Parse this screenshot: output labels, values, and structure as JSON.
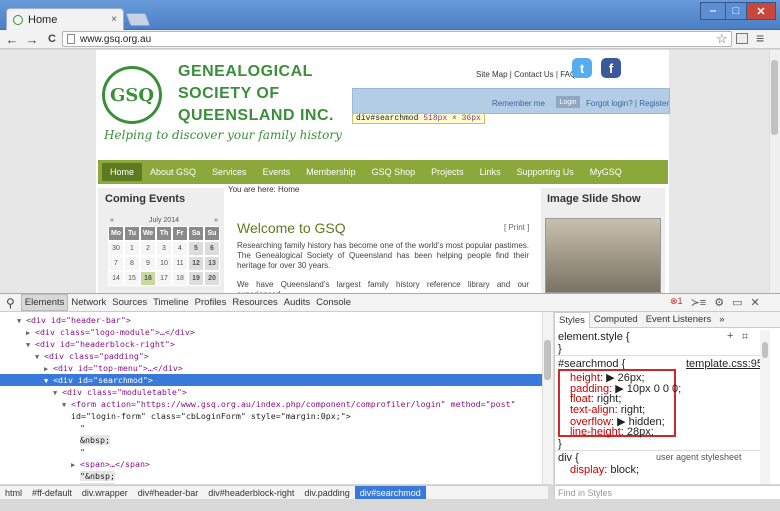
{
  "browser": {
    "tab_title": "Home",
    "tab_close": "×",
    "url": "www.gsq.org.au",
    "window_buttons": {
      "minimize": "‒",
      "maximize": "□",
      "close": "✕"
    },
    "nav": {
      "back": "←",
      "forward": "→",
      "reload": "C",
      "star": "☆",
      "menu": "≡"
    }
  },
  "site": {
    "logo_text": "GSQ",
    "name_lines": [
      "GENEALOGICAL",
      "SOCIETY OF",
      "QUEENSLAND INC."
    ],
    "tagline": "Helping to discover your family history",
    "top_links": "Site Map | Contact Us | FAQ",
    "twitter": "t",
    "facebook": "f",
    "remember_me": "Remember me",
    "login_button": "Login",
    "forgot_links": "Forgot login? | Register",
    "menu": [
      "Home",
      "About GSQ",
      "Services",
      "Events",
      "Membership",
      "GSQ Shop",
      "Projects",
      "Links",
      "Supporting Us",
      "MyGSQ"
    ],
    "coming_events": "Coming Events",
    "calendar": {
      "month": "July 2014",
      "prev": "«",
      "next": "»",
      "days": [
        "Mo",
        "Tu",
        "We",
        "Th",
        "Fr",
        "Sa",
        "Su"
      ],
      "rows": [
        [
          "30",
          "1",
          "2",
          "3",
          "4",
          "5",
          "6"
        ],
        [
          "7",
          "8",
          "9",
          "10",
          "11",
          "12",
          "13"
        ],
        [
          "14",
          "15",
          "16",
          "17",
          "18",
          "19",
          "20"
        ]
      ]
    },
    "breadcrumb": "You are here: Home",
    "welcome_title": "Welcome to GSQ",
    "print_link": "[ Print ]",
    "paragraph1": "Researching family history has become one of the world’s most popular pastimes. The Genealogical Society of Queensland has been helping people find their heritage for over 30 years.",
    "paragraph2": "We have Queensland’s largest family history reference library and our experienced",
    "image_slide_show": "Image Slide Show",
    "tooltip_selector": "div#searchmod",
    "tooltip_size": "518px × 36px"
  },
  "devtools": {
    "tabs": [
      "Elements",
      "Network",
      "Sources",
      "Timeline",
      "Profiles",
      "Resources",
      "Audits",
      "Console"
    ],
    "error_count": "1",
    "dom_lines": [
      {
        "indent": 3,
        "open": true,
        "tag": "<div id=\"header-bar\">"
      },
      {
        "indent": 4,
        "open": false,
        "tag": "<div class=\"logo-module\">…</div>"
      },
      {
        "indent": 4,
        "open": true,
        "tag": "<div id=\"headerblock-right\">"
      },
      {
        "indent": 5,
        "open": true,
        "tag": "<div class=\"padding\">"
      },
      {
        "indent": 6,
        "open": false,
        "tag": "<div id=\"top-menu\">…</div>"
      },
      {
        "indent": 6,
        "open": true,
        "tag": "<div id=\"searchmod\">"
      },
      {
        "indent": 7,
        "open": true,
        "tag": "<div class=\"moduletable\">"
      },
      {
        "indent": 8,
        "open": true,
        "tag": "<form action=\"https://www.gsq.org.au/index.php/component/comprofiler/login\" method=\"post\""
      },
      {
        "indent": 8,
        "open": null,
        "tag": "id=\"login-form\" class=\"cbLoginForm\" style=\"margin:0px;\">"
      },
      {
        "indent": 9,
        "open": null,
        "tag": "\""
      },
      {
        "indent": 9,
        "open": null,
        "tag": "&nbsp;"
      },
      {
        "indent": 9,
        "open": null,
        "tag": "\""
      },
      {
        "indent": 9,
        "open": false,
        "tag": "<span>…</span>"
      },
      {
        "indent": 9,
        "open": null,
        "tag": "\"&nbsp;"
      },
      {
        "indent": 9,
        "open": null,
        "tag": "&nbsp;\""
      }
    ],
    "styles_tabs": [
      "Styles",
      "Computed",
      "Event Listeners",
      "»"
    ],
    "element_style": "element.style {",
    "element_style_close": "}",
    "rule_selector": "#searchmod {",
    "rule_source": "template.css:95",
    "declarations": [
      {
        "prop": "height",
        "value": "▶ 26px;"
      },
      {
        "prop": "padding",
        "value": "▶ 10px 0 0 0;"
      },
      {
        "prop": "float",
        "value": "right;"
      },
      {
        "prop": "text-align",
        "value": "right;"
      },
      {
        "prop": "overflow",
        "value": "▶ hidden;"
      },
      {
        "prop": "line-height",
        "value": "28px;"
      }
    ],
    "rule_close": "}",
    "ua_selector": "div {",
    "ua_source": "user agent stylesheet",
    "ua_decl_prop": "display",
    "ua_decl_value": "block;",
    "breadcrumbs": [
      "html",
      "#ff-default",
      "div.wrapper",
      "div#header-bar",
      "div#headerblock-right",
      "div.padding",
      "div#searchmod"
    ],
    "find_placeholder": "Find in Styles"
  }
}
